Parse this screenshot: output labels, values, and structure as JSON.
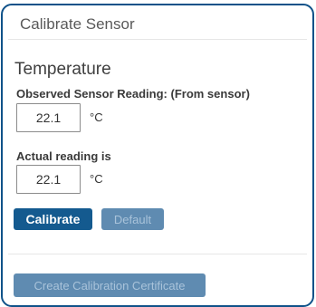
{
  "panel": {
    "title": "Calibrate Sensor",
    "section_title": "Temperature"
  },
  "observed": {
    "label": "Observed Sensor Reading: (From sensor)",
    "value": "22.1",
    "unit": "°C"
  },
  "actual": {
    "label": "Actual reading is",
    "value": "22.1",
    "unit": "°C"
  },
  "buttons": {
    "calibrate": "Calibrate",
    "default": "Default",
    "create_certificate": "Create Calibration Certificate"
  },
  "colors": {
    "panel_border": "#0f5289",
    "primary_button": "#145a8f",
    "disabled_button": "#5f8bb1"
  }
}
